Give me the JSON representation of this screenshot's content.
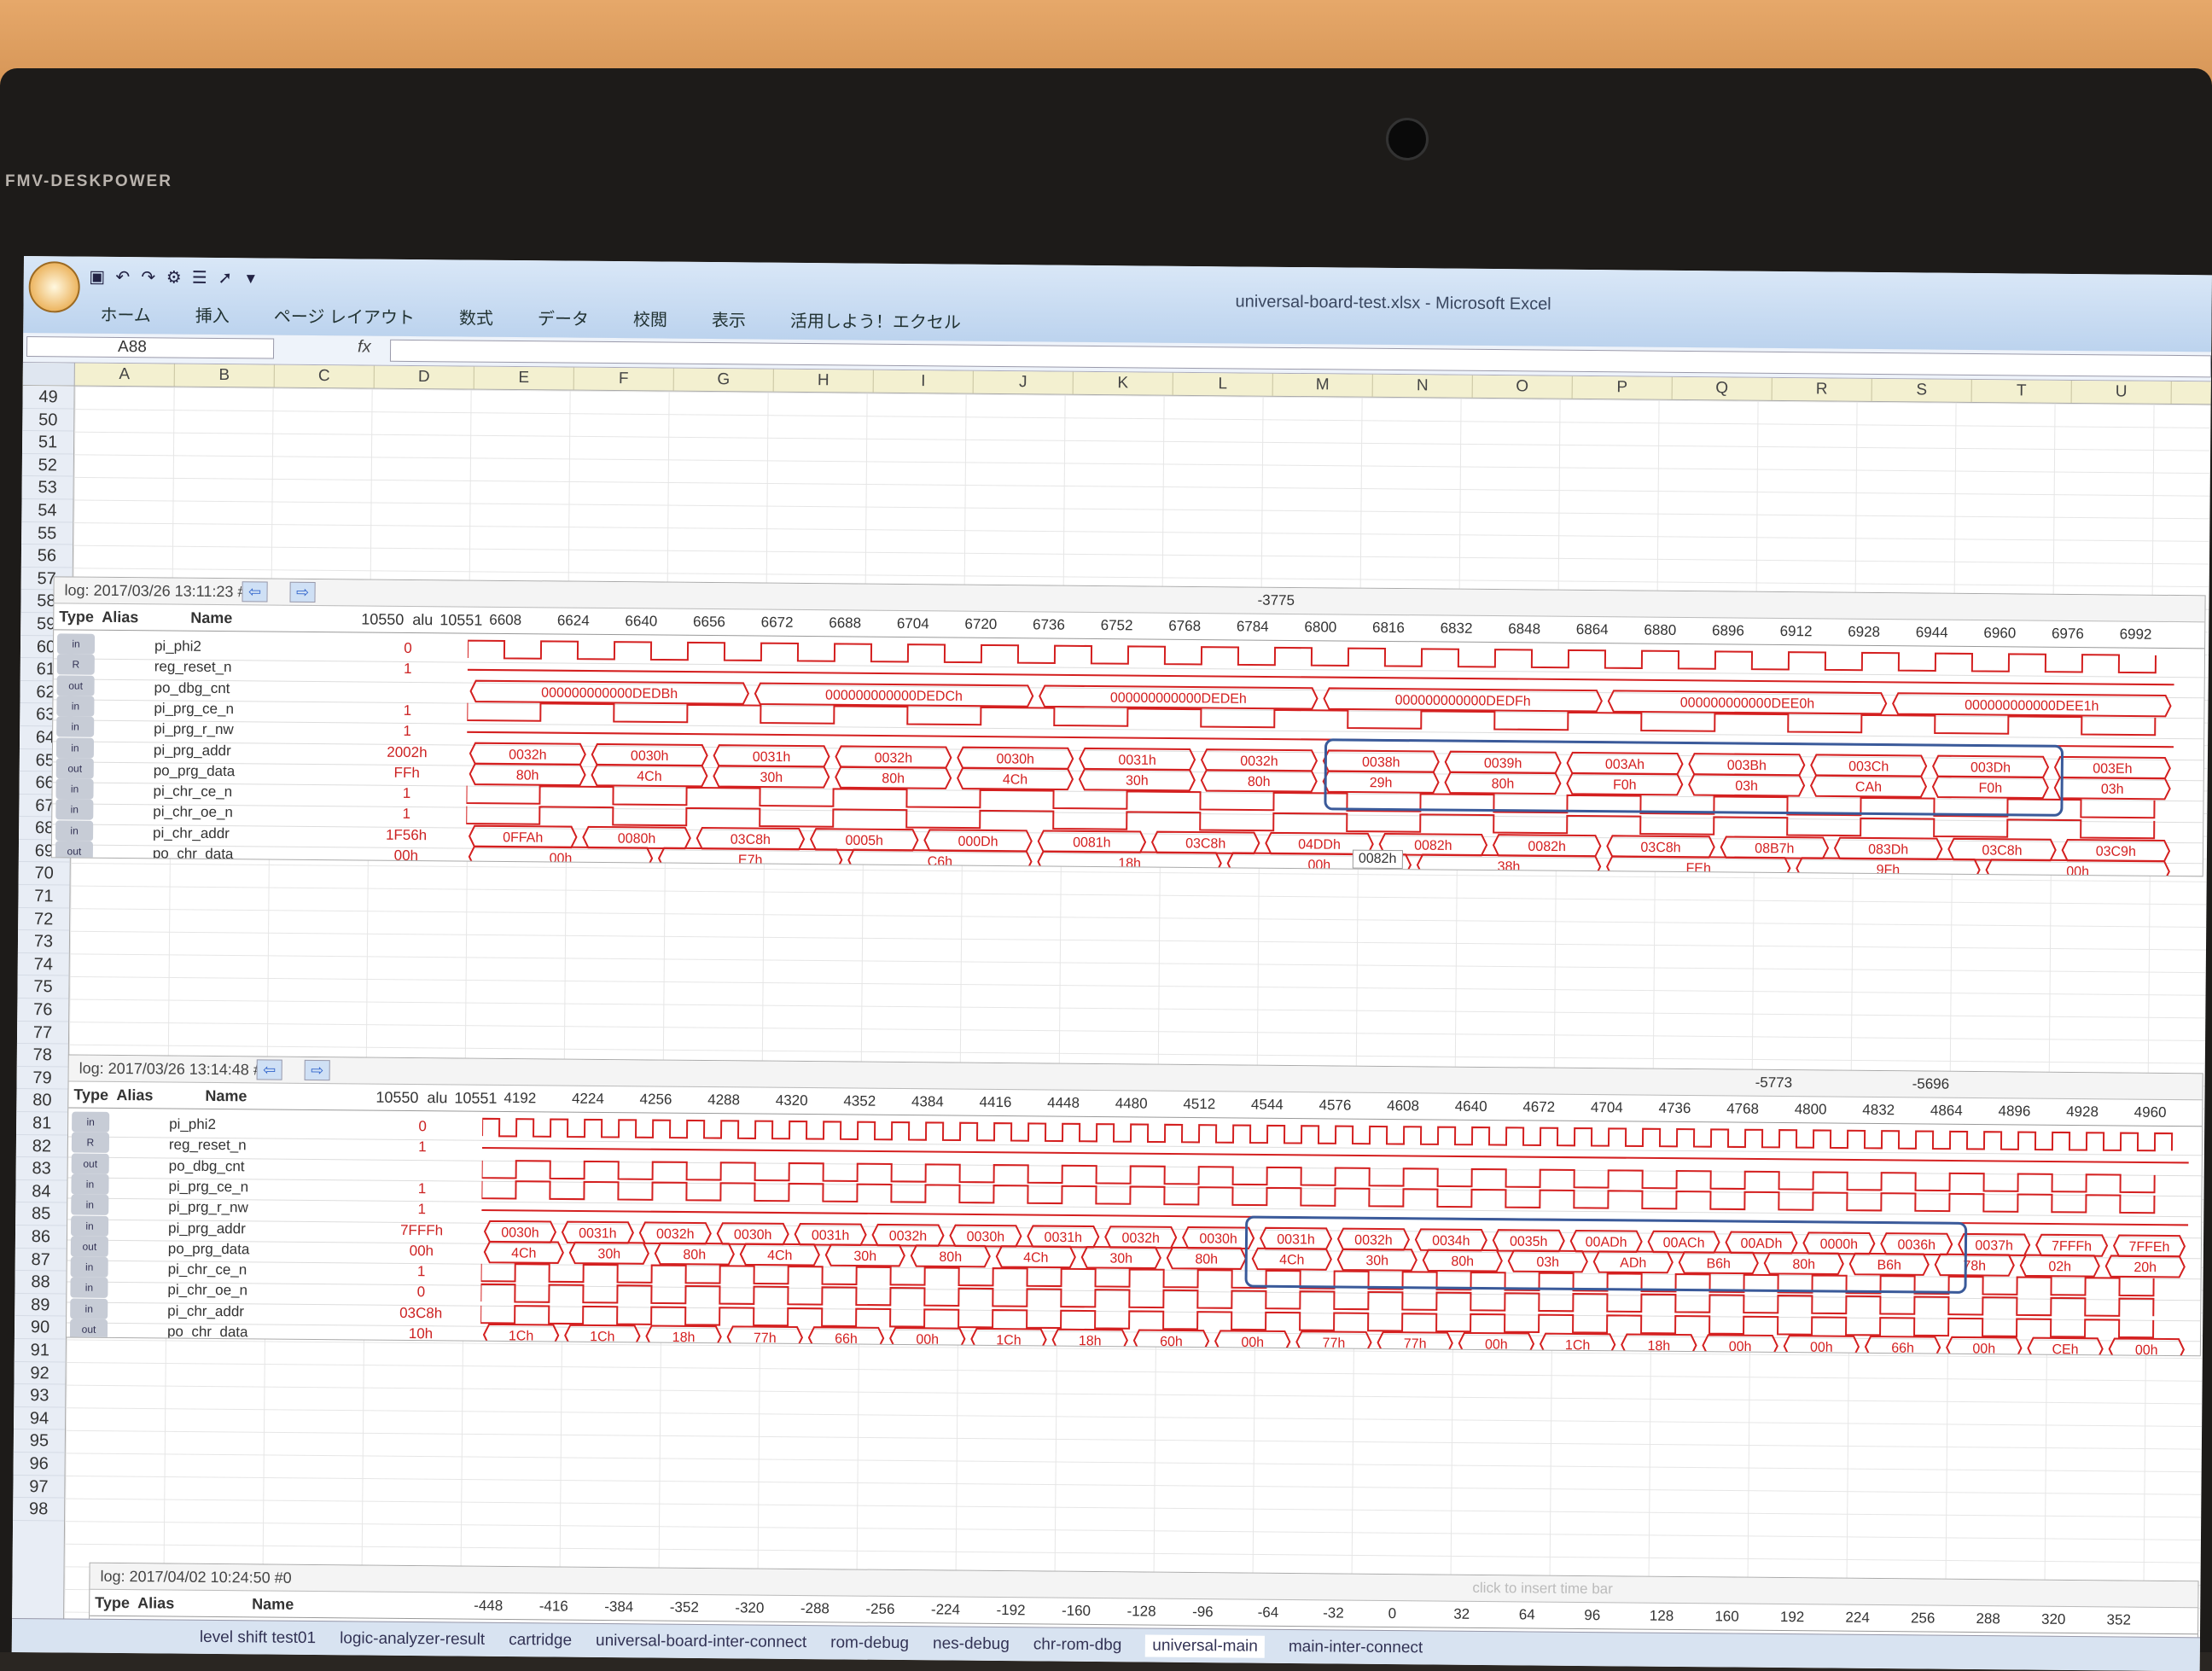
{
  "device": {
    "brand": "FMV-DESKPOWER"
  },
  "window": {
    "title": "universal-board-test.xlsx - Microsoft Excel"
  },
  "ribbon_tabs": [
    "ホーム",
    "挿入",
    "ページ レイアウト",
    "数式",
    "データ",
    "校閲",
    "表示",
    "活用しよう！エクセル"
  ],
  "formula_bar": {
    "name_box": "A88",
    "fx": "fx"
  },
  "columns": [
    "A",
    "B",
    "C",
    "D",
    "E",
    "F",
    "G",
    "H",
    "I",
    "J",
    "K",
    "L",
    "M",
    "N",
    "O",
    "P",
    "Q",
    "R",
    "S",
    "T",
    "U"
  ],
  "rows": [
    "49",
    "50",
    "51",
    "52",
    "53",
    "54",
    "55",
    "56",
    "57",
    "58",
    "59",
    "60",
    "61",
    "62",
    "63",
    "64",
    "65",
    "66",
    "67",
    "68",
    "69",
    "70",
    "71",
    "72",
    "73",
    "74",
    "75",
    "76",
    "77",
    "78",
    "79",
    "80",
    "81",
    "82",
    "83",
    "84",
    "85",
    "86",
    "87",
    "88",
    "89",
    "90",
    "91",
    "92",
    "93",
    "94",
    "95",
    "96",
    "97",
    "98"
  ],
  "la_columns": {
    "type": "Type",
    "alias": "Alias",
    "name": "Name"
  },
  "panel1": {
    "log": "log: 2017/03/26 13:11:23 #0",
    "cursor": "10550",
    "cursor2": "10551",
    "alu": "alu",
    "marker": "-3775",
    "ticks": [
      "6608",
      "6624",
      "6640",
      "6656",
      "6672",
      "6688",
      "6704",
      "6720",
      "6736",
      "6752",
      "6768",
      "6784",
      "6800",
      "6816",
      "6832",
      "6848",
      "6864",
      "6880",
      "6896",
      "6912",
      "6928",
      "6944",
      "6960",
      "6976",
      "6992"
    ],
    "tooltip": "0082h",
    "signals": [
      {
        "type": "in",
        "name": "pi_phi2",
        "value": "0"
      },
      {
        "type": "R",
        "name": "reg_reset_n",
        "value": "1"
      },
      {
        "type": "out",
        "name": "po_dbg_cnt",
        "value": "",
        "labels": [
          "000000000000DEDBh",
          "000000000000DEDCh",
          "000000000000DEDEh",
          "000000000000DEDFh",
          "000000000000DEE0h",
          "000000000000DEE1h"
        ]
      },
      {
        "type": "in",
        "name": "pi_prg_ce_n",
        "value": "1"
      },
      {
        "type": "in",
        "name": "pi_prg_r_nw",
        "value": "1"
      },
      {
        "type": "in",
        "name": "pi_prg_addr",
        "value": "2002h",
        "labels": [
          "0032h",
          "0030h",
          "0031h",
          "0032h",
          "0030h",
          "0031h",
          "0032h",
          "0038h",
          "0039h",
          "003Ah",
          "003Bh",
          "003Ch",
          "003Dh",
          "003Eh"
        ]
      },
      {
        "type": "out",
        "name": "po_prg_data",
        "value": "FFh",
        "labels": [
          "80h",
          "4Ch",
          "30h",
          "80h",
          "4Ch",
          "30h",
          "80h",
          "29h",
          "80h",
          "F0h",
          "03h",
          "CAh",
          "F0h",
          "03h"
        ]
      },
      {
        "type": "in",
        "name": "pi_chr_ce_n",
        "value": "1"
      },
      {
        "type": "in",
        "name": "pi_chr_oe_n",
        "value": "1"
      },
      {
        "type": "in",
        "name": "pi_chr_addr",
        "value": "1F56h",
        "labels": [
          "0FFAh",
          "0080h",
          "03C8h",
          "0005h",
          "000Dh",
          "0081h",
          "03C8h",
          "04DDh",
          "0082h",
          "0082h",
          "03C8h",
          "08B7h",
          "083Dh",
          "03C8h",
          "03C9h"
        ]
      },
      {
        "type": "out",
        "name": "po_chr_data",
        "value": "00h",
        "labels": [
          "00h",
          "E7h",
          "C6h",
          "18h",
          "00h",
          "38h",
          "FEh",
          "9Fh",
          "00h"
        ]
      }
    ]
  },
  "panel2": {
    "log": "log: 2017/03/26 13:14:48 #0",
    "cursor": "10550",
    "cursor2": "10551",
    "alu": "alu",
    "marker_a": "-5773",
    "marker_b": "-5696",
    "ticks": [
      "4192",
      "4224",
      "4256",
      "4288",
      "4320",
      "4352",
      "4384",
      "4416",
      "4448",
      "4480",
      "4512",
      "4544",
      "4576",
      "4608",
      "4640",
      "4672",
      "4704",
      "4736",
      "4768",
      "4800",
      "4832",
      "4864",
      "4896",
      "4928",
      "4960"
    ],
    "signals": [
      {
        "type": "in",
        "name": "pi_phi2",
        "value": "0"
      },
      {
        "type": "R",
        "name": "reg_reset_n",
        "value": "1"
      },
      {
        "type": "out",
        "name": "po_dbg_cnt",
        "value": ""
      },
      {
        "type": "in",
        "name": "pi_prg_ce_n",
        "value": "1"
      },
      {
        "type": "in",
        "name": "pi_prg_r_nw",
        "value": "1"
      },
      {
        "type": "in",
        "name": "pi_prg_addr",
        "value": "7FFFh",
        "labels": [
          "0030h",
          "0031h",
          "0032h",
          "0030h",
          "0031h",
          "0032h",
          "0030h",
          "0031h",
          "0032h",
          "0030h",
          "0031h",
          "0032h",
          "0034h",
          "0035h",
          "00ADh",
          "00ACh",
          "00ADh",
          "0000h",
          "0036h",
          "0037h",
          "7FFFh",
          "7FFEh"
        ]
      },
      {
        "type": "out",
        "name": "po_prg_data",
        "value": "00h",
        "labels": [
          "4Ch",
          "30h",
          "80h",
          "4Ch",
          "30h",
          "80h",
          "4Ch",
          "30h",
          "80h",
          "4Ch",
          "30h",
          "80h",
          "03h",
          "ADh",
          "B6h",
          "80h",
          "B6h",
          "78h",
          "02h",
          "20h"
        ]
      },
      {
        "type": "in",
        "name": "pi_chr_ce_n",
        "value": "1"
      },
      {
        "type": "in",
        "name": "pi_chr_oe_n",
        "value": "0"
      },
      {
        "type": "in",
        "name": "pi_chr_addr",
        "value": "03C8h"
      },
      {
        "type": "out",
        "name": "po_chr_data",
        "value": "10h",
        "labels": [
          "1Ch",
          "1Ch",
          "18h",
          "77h",
          "66h",
          "00h",
          "1Ch",
          "18h",
          "60h",
          "00h",
          "77h",
          "77h",
          "00h",
          "1Ch",
          "18h",
          "00h",
          "00h",
          "66h",
          "00h",
          "CEh",
          "00h"
        ]
      }
    ]
  },
  "panel3": {
    "log": "log: 2017/04/02 10:24:50 #0",
    "hint": "click to insert time bar",
    "ticks": [
      "-448",
      "-416",
      "-384",
      "-352",
      "-320",
      "-288",
      "-256",
      "-224",
      "-192",
      "-160",
      "-128",
      "-96",
      "-64",
      "-32",
      "0",
      "32",
      "64",
      "96",
      "128",
      "160",
      "192",
      "224",
      "256",
      "288",
      "320",
      "352"
    ]
  },
  "sheet_tabs": [
    "level shift test01",
    "logic-analyzer-result",
    "cartridge",
    "universal-board-inter-connect",
    "rom-debug",
    "nes-debug",
    "chr-rom-dbg",
    "universal-main",
    "main-inter-connect"
  ],
  "colors": {
    "wave": "#d42020",
    "highlight": "#3a5a9a"
  }
}
